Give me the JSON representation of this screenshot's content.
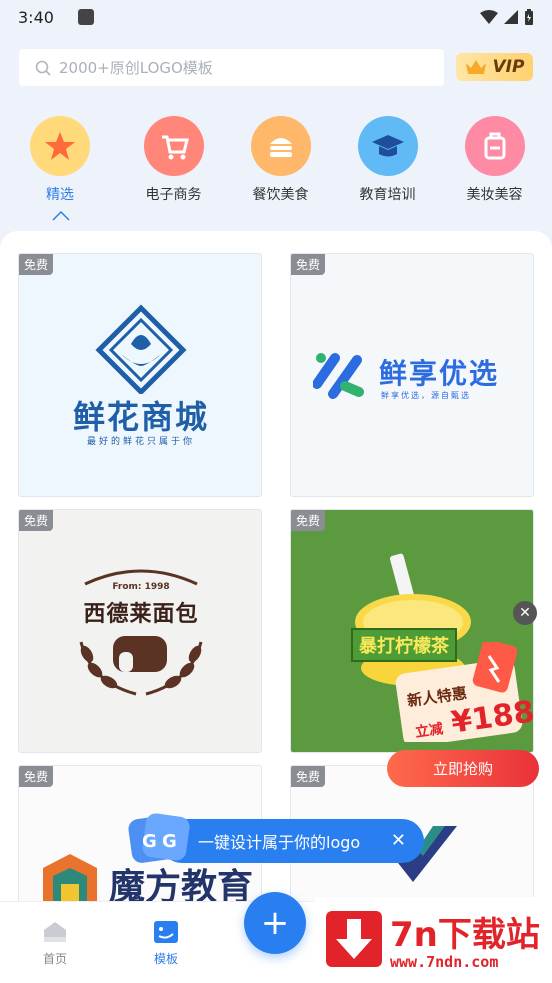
{
  "status_bar": {
    "time": "3:40"
  },
  "search": {
    "placeholder": "2000+原创LOGO模板"
  },
  "vip": {
    "label": "VIP"
  },
  "categories": [
    {
      "label": "精选",
      "color": "#ffb845"
    },
    {
      "label": "电子商务",
      "color": "#ff6b5d"
    },
    {
      "label": "餐饮美食",
      "color": "#ffa24a"
    },
    {
      "label": "教育培训",
      "color": "#37a7f3"
    },
    {
      "label": "美妆美容",
      "color": "#ff6d8e"
    }
  ],
  "cards": [
    {
      "badge": "免费",
      "title": "鲜花商城",
      "subtitle": "最好的鲜花只属于你"
    },
    {
      "badge": "免费",
      "title": "鲜享优选",
      "subtitle": "鲜享优选，源自甄选"
    },
    {
      "badge": "免费",
      "title": "西德莱面包",
      "subtitle": "From: 1998"
    },
    {
      "badge": "免费",
      "title": "暴打柠檬茶"
    },
    {
      "badge": "免费",
      "title": "魔方教育"
    },
    {
      "badge": "免费"
    }
  ],
  "promo": {
    "title": "新人特惠",
    "discount_label": "立减",
    "amount": "¥188",
    "button": "立即抢购",
    "close": "✕"
  },
  "tip": {
    "text": "一键设计属于你的logo",
    "close": "✕"
  },
  "bottom_nav": [
    {
      "label": "首页"
    },
    {
      "label": "模板"
    }
  ],
  "fab": {
    "label": "+"
  },
  "watermark": {
    "title": "7n下载站",
    "url": "www.7ndn.com"
  }
}
